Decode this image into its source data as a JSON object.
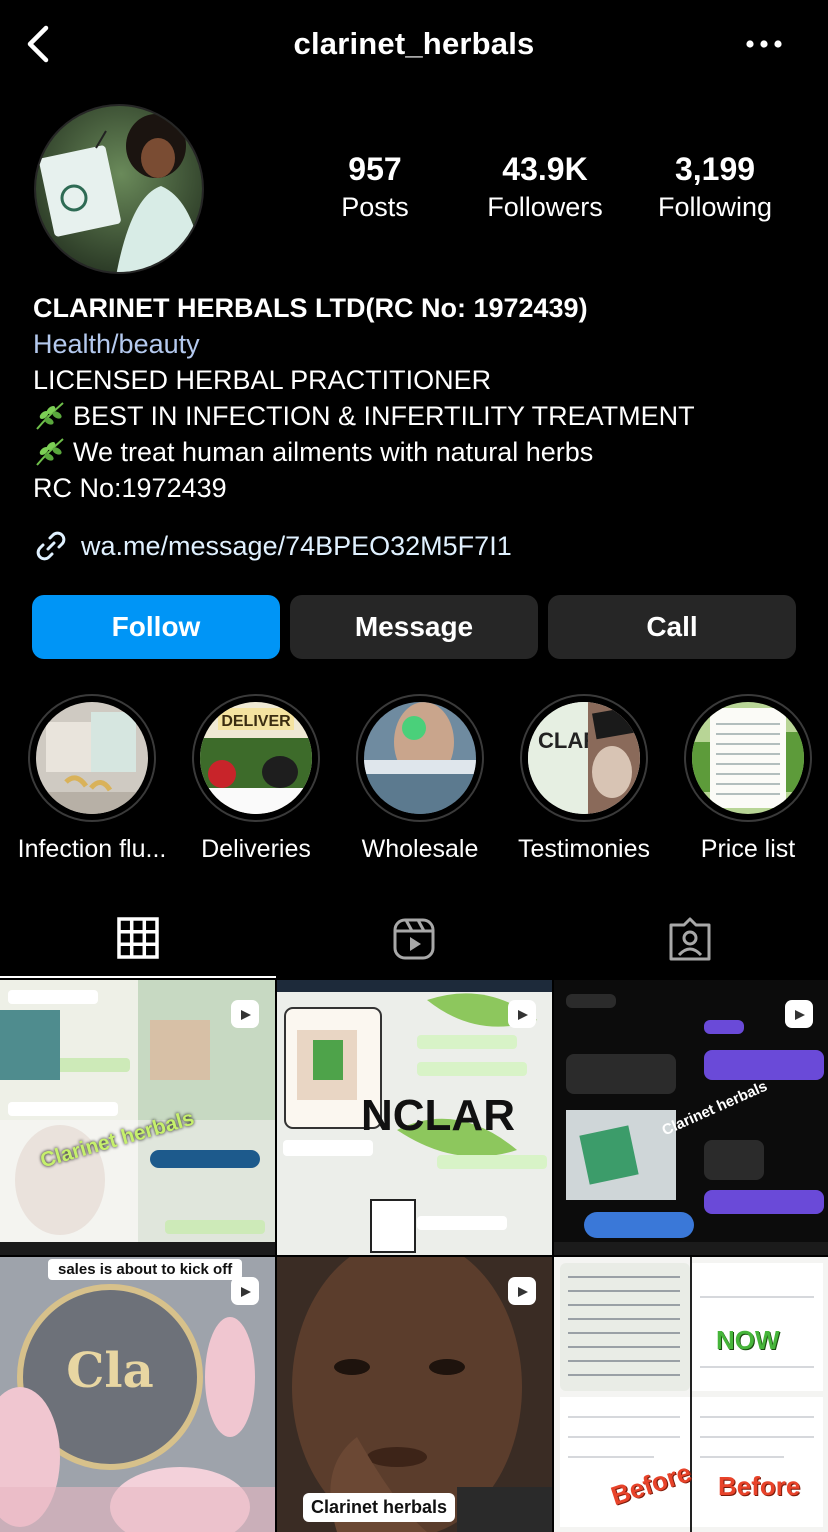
{
  "header": {
    "username": "clarinet_herbals",
    "back_icon": "chevron-left-icon",
    "more_icon": "more-horizontal-icon"
  },
  "stats": {
    "posts_value": "957",
    "posts_label": "Posts",
    "followers_value": "43.9K",
    "followers_label": "Followers",
    "following_value": "3,199",
    "following_label": "Following"
  },
  "bio": {
    "name": "CLARINET HERBALS LTD(RC No: 1972439)",
    "category": "Health/beauty",
    "line1": "LICENSED HERBAL PRACTITIONER",
    "line2": "BEST IN INFECTION & INFERTILITY TREATMENT",
    "line3": "We treat human ailments with natural herbs",
    "line4": "RC No:1972439"
  },
  "link": {
    "text": "wa.me/message/74BPEO32M5F7I1"
  },
  "buttons": {
    "follow": "Follow",
    "message": "Message",
    "call": "Call"
  },
  "highlights": [
    {
      "label": "Infection flu..."
    },
    {
      "label": "Deliveries"
    },
    {
      "label": "Wholesale"
    },
    {
      "label": "Testimonies"
    },
    {
      "label": "Price list"
    }
  ],
  "tabs": [
    "grid-icon",
    "reels-icon",
    "tagged-icon"
  ],
  "posts": {
    "p1_caption": "Clarinet herbals",
    "p4_caption": "sales is about to kick off",
    "p5_caption": "Clarinet herbals",
    "p6_caption_before": "Before",
    "p6_caption_now": "NOW"
  },
  "colors": {
    "accent": "#0095f6",
    "secondary_button": "#262626",
    "category": "#b4c9ee",
    "link": "#e0f1ff"
  }
}
